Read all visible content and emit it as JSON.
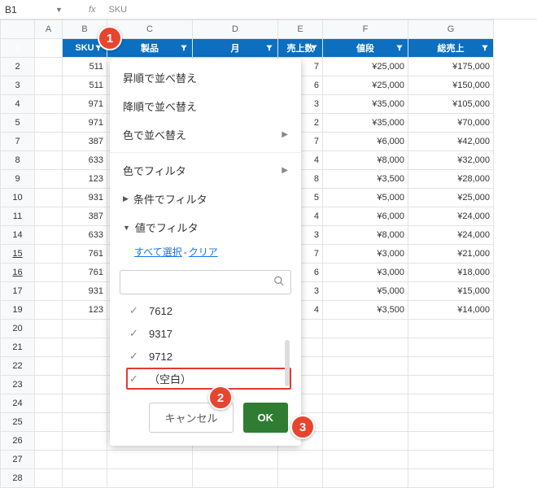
{
  "formula_bar": {
    "cell_ref": "B1",
    "fx_label": "fx",
    "fx_value": "SKU"
  },
  "col_letters": [
    "A",
    "B",
    "C",
    "D",
    "E",
    "F",
    "G"
  ],
  "headers": {
    "B": "SKU",
    "C": "製品",
    "D": "月",
    "E": "売上数",
    "F": "値段",
    "G": "総売上"
  },
  "rows": [
    {
      "num": "1",
      "B": "SKU",
      "E": "売上数",
      "F": "値段",
      "G": "総売上",
      "header": true
    },
    {
      "num": "2",
      "B": "511",
      "E": "7",
      "F": "¥25,000",
      "G": "¥175,000"
    },
    {
      "num": "3",
      "B": "511",
      "E": "6",
      "F": "¥25,000",
      "G": "¥150,000"
    },
    {
      "num": "4",
      "B": "971",
      "E": "3",
      "F": "¥35,000",
      "G": "¥105,000"
    },
    {
      "num": "5",
      "B": "971",
      "E": "2",
      "F": "¥35,000",
      "G": "¥70,000"
    },
    {
      "num": "7",
      "B": "387",
      "E": "7",
      "F": "¥6,000",
      "G": "¥42,000"
    },
    {
      "num": "8",
      "B": "633",
      "E": "4",
      "F": "¥8,000",
      "G": "¥32,000"
    },
    {
      "num": "9",
      "B": "123",
      "E": "8",
      "F": "¥3,500",
      "G": "¥28,000"
    },
    {
      "num": "10",
      "B": "931",
      "E": "5",
      "F": "¥5,000",
      "G": "¥25,000"
    },
    {
      "num": "11",
      "B": "387",
      "E": "4",
      "F": "¥6,000",
      "G": "¥24,000"
    },
    {
      "num": "14",
      "B": "633",
      "E": "3",
      "F": "¥8,000",
      "G": "¥24,000"
    },
    {
      "num": "15",
      "B": "761",
      "E": "7",
      "F": "¥3,000",
      "G": "¥21,000",
      "underline": true
    },
    {
      "num": "16",
      "B": "761",
      "E": "6",
      "F": "¥3,000",
      "G": "¥18,000",
      "underline": true
    },
    {
      "num": "17",
      "B": "931",
      "E": "3",
      "F": "¥5,000",
      "G": "¥15,000"
    },
    {
      "num": "19",
      "B": "123",
      "E": "4",
      "F": "¥3,500",
      "G": "¥14,000"
    },
    {
      "num": "20"
    },
    {
      "num": "21"
    },
    {
      "num": "22"
    },
    {
      "num": "23"
    },
    {
      "num": "24"
    },
    {
      "num": "25"
    },
    {
      "num": "26"
    },
    {
      "num": "27"
    },
    {
      "num": "28"
    }
  ],
  "filter_menu": {
    "sort_asc": "昇順で並べ替え",
    "sort_desc": "降順で並べ替え",
    "sort_color": "色で並べ替え",
    "filter_color": "色でフィルタ",
    "filter_cond": "条件でフィルタ",
    "filter_value": "値でフィルタ",
    "select_all": "すべて選択",
    "clear": "クリア",
    "search_placeholder": "",
    "options": [
      {
        "label": "7612",
        "checked": true
      },
      {
        "label": "9317",
        "checked": true
      },
      {
        "label": "9712",
        "checked": true
      },
      {
        "label": "（空白）",
        "checked": true,
        "highlight": true
      }
    ],
    "cancel": "キャンセル",
    "ok": "OK"
  },
  "annotations": {
    "one": "1",
    "two": "2",
    "three": "3"
  }
}
